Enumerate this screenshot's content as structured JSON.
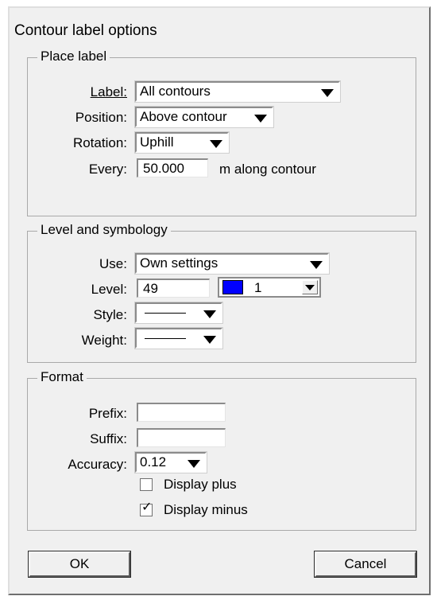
{
  "window": {
    "title": "Contour label options"
  },
  "place_label": {
    "group_title": "Place label",
    "label": {
      "caption": "Label:",
      "value": "All contours"
    },
    "position": {
      "caption": "Position:",
      "value": "Above contour"
    },
    "rotation": {
      "caption": "Rotation:",
      "value": "Uphill"
    },
    "every": {
      "caption": "Every:",
      "value": "50.000",
      "suffix": "m along contour"
    }
  },
  "level_symbology": {
    "group_title": "Level and symbology",
    "use": {
      "caption": "Use:",
      "value": "Own settings"
    },
    "level": {
      "caption": "Level:",
      "value": "49",
      "color_index": "1",
      "color": "#0000ff"
    },
    "style": {
      "caption": "Style:"
    },
    "weight": {
      "caption": "Weight:"
    }
  },
  "format": {
    "group_title": "Format",
    "prefix": {
      "caption": "Prefix:",
      "value": ""
    },
    "suffix": {
      "caption": "Suffix:",
      "value": ""
    },
    "accuracy": {
      "caption": "Accuracy:",
      "value": "0.12"
    },
    "display_plus": {
      "label": "Display plus",
      "checked": false
    },
    "display_minus": {
      "label": "Display minus",
      "checked": true
    }
  },
  "buttons": {
    "ok": "OK",
    "cancel": "Cancel"
  }
}
